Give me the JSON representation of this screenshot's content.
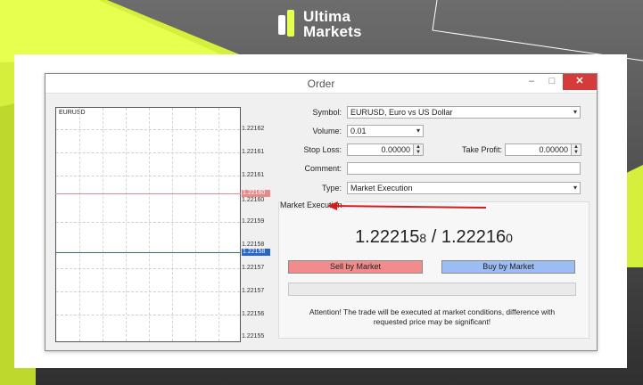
{
  "brand": {
    "line1": "Ultima",
    "line2": "Markets"
  },
  "window": {
    "title": "Order",
    "min_glyph": "–",
    "max_glyph": "□",
    "close_glyph": "✕"
  },
  "chart": {
    "symbol": "EURUSD",
    "ticks": [
      "1.22162",
      "1.22161",
      "1.22161",
      "1.22160",
      "1.22159",
      "1.22158",
      "1.22157",
      "1.22157",
      "1.22156",
      "1.22155"
    ],
    "ask_tag": "1.22160",
    "bid_tag": "1.22158"
  },
  "form": {
    "symbol_label": "Symbol:",
    "symbol_value": "EURUSD, Euro vs US Dollar",
    "volume_label": "Volume:",
    "volume_value": "0.01",
    "stoploss_label": "Stop Loss:",
    "stoploss_value": "0.00000",
    "takeprofit_label": "Take Profit:",
    "takeprofit_value": "0.00000",
    "comment_label": "Comment:",
    "comment_value": "",
    "type_label": "Type:",
    "type_value": "Market Execution"
  },
  "execution": {
    "title": "Market Execution",
    "bid_main": "1.22215",
    "bid_last": "8",
    "separator": " / ",
    "ask_main": "1.22216",
    "ask_last": "0",
    "sell_label": "Sell by Market",
    "buy_label": "Buy by Market",
    "attention_line1": "Attention! The trade will be executed at market conditions, difference with",
    "attention_line2": "requested price may be significant!"
  },
  "icons": {
    "dropdown": "chevron-down-icon",
    "spinner": "spin-updown-icon",
    "annotation": "red-arrow-icon"
  },
  "colors": {
    "accent_lime": "#e7ff4f",
    "sell": "#f28c8c",
    "buy": "#9cbcf4",
    "close": "#d63b3b"
  }
}
